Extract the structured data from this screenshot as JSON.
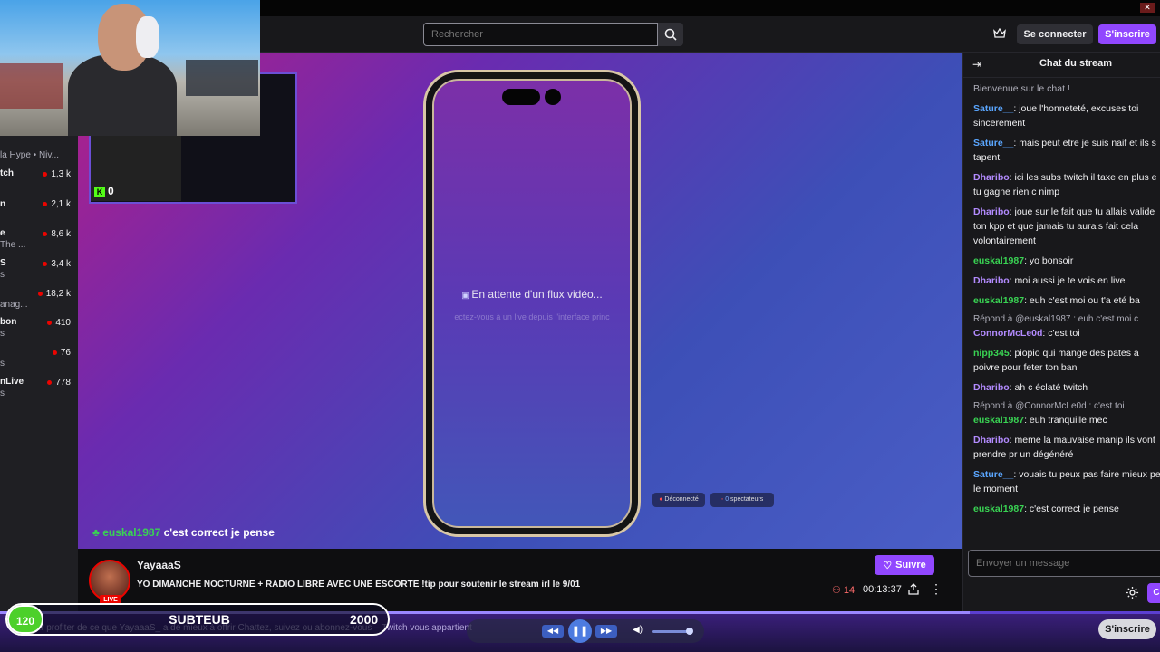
{
  "window": {
    "close_label": "✕"
  },
  "header": {
    "search_placeholder": "Rechercher",
    "login_label": "Se connecter",
    "signup_label": "S'inscrire"
  },
  "sidebar": {
    "header_text": "la Hype • Niv...",
    "items": [
      {
        "name": "tch",
        "sub": "",
        "count": "1,3 k"
      },
      {
        "name": "n",
        "sub": "",
        "count": "2,1 k"
      },
      {
        "name": "e",
        "sub": "The ...",
        "count": "8,6 k"
      },
      {
        "name": "S",
        "sub": "s",
        "count": "3,4 k"
      },
      {
        "name": "",
        "sub": "anag...",
        "count": "18,2 k"
      },
      {
        "name": "bon",
        "sub": "s",
        "count": "410"
      },
      {
        "name": "",
        "sub": "s",
        "count": "76"
      },
      {
        "name": "nLive",
        "sub": "s",
        "count": "778"
      }
    ]
  },
  "webcam": {
    "counter": "0"
  },
  "stream": {
    "waiting_text": "En attente d'un flux vidéo...",
    "waiting_sub": "ectez-vous à un live depuis l'interface princ",
    "status_pill": "Déconnecté",
    "viewers_pill_count": "0",
    "viewers_pill_label": "spectateurs",
    "overlay_chat_user": "euskal1987",
    "overlay_chat_text": "c'est correct je pense"
  },
  "channel": {
    "streamer": "YayaaaS_",
    "live_label": "LIVE",
    "title": "YO DIMANCHE NOCTURNE + RADIO LIBRE AVEC UNE ESCORTE !tip pour soutenir le stream irl le 9/01",
    "follow_label": "Suivre",
    "viewers": "14",
    "uptime": "00:13:37"
  },
  "chat": {
    "title": "Chat du stream",
    "input_placeholder": "Envoyer un message",
    "send_label": "C",
    "messages": [
      {
        "user": "",
        "color": "#adadb8",
        "text": "Bienvenue sur le chat !",
        "reply": ""
      },
      {
        "user": "Sature__",
        "color": "#5aa6ff",
        "text": ": joue l'honneteté, excuses toi sincerement",
        "reply": ""
      },
      {
        "user": "Sature__",
        "color": "#5aa6ff",
        "text": ": mais peut etre je suis naif et ils s tapent",
        "reply": ""
      },
      {
        "user": "Dharibo",
        "color": "#b38bff",
        "text": ": ici les subs twitch il taxe en plus e tu gagne rien c nimp",
        "reply": ""
      },
      {
        "user": "Dharibo",
        "color": "#b38bff",
        "text": ": joue sur le fait que tu allais valide ton kpp et que jamais tu aurais fait cela volontairement",
        "reply": ""
      },
      {
        "user": "euskal1987",
        "color": "#39d353",
        "text": ": yo bonsoir",
        "reply": ""
      },
      {
        "user": "Dharibo",
        "color": "#b38bff",
        "text": ": moi aussi je te vois en live",
        "reply": ""
      },
      {
        "user": "euskal1987",
        "color": "#39d353",
        "text": ": euh c'est moi ou t'a eté ba",
        "reply": ""
      },
      {
        "user": "ConnorMcLe0d",
        "color": "#b38bff",
        "text": ": c'est toi",
        "reply": "Répond à @euskal1987 : euh c'est moi c"
      },
      {
        "user": "nipp345",
        "color": "#39d353",
        "text": ": piopio qui mange des pates a poivre pour feter ton ban",
        "reply": ""
      },
      {
        "user": "Dharibo",
        "color": "#b38bff",
        "text": ": ah c éclaté twitch",
        "reply": ""
      },
      {
        "user": "euskal1987",
        "color": "#39d353",
        "text": ": euh tranquille mec",
        "reply": "Répond à @ConnorMcLe0d : c'est toi"
      },
      {
        "user": "Dharibo",
        "color": "#b38bff",
        "text": ": meme la mauvaise manip ils vont prendre pr un dégénéré",
        "reply": ""
      },
      {
        "user": "Sature__",
        "color": "#5aa6ff",
        "text": ": vouais tu peux pas faire mieux pe le moment",
        "reply": ""
      },
      {
        "user": "euskal1987",
        "color": "#39d353",
        "text": ": c'est correct je pense",
        "reply": ""
      }
    ]
  },
  "bottom": {
    "ticker": "our profiter de ce que YayaaaS_ a de mieux à offrir  Chattez, suivez ou abonnez-vous – Twitch vous appartient",
    "subgoal_current": "120",
    "subgoal_label": "SUBTEUB",
    "subgoal_target": "2000",
    "signup_label": "S'inscrire",
    "progress": 0.836
  }
}
